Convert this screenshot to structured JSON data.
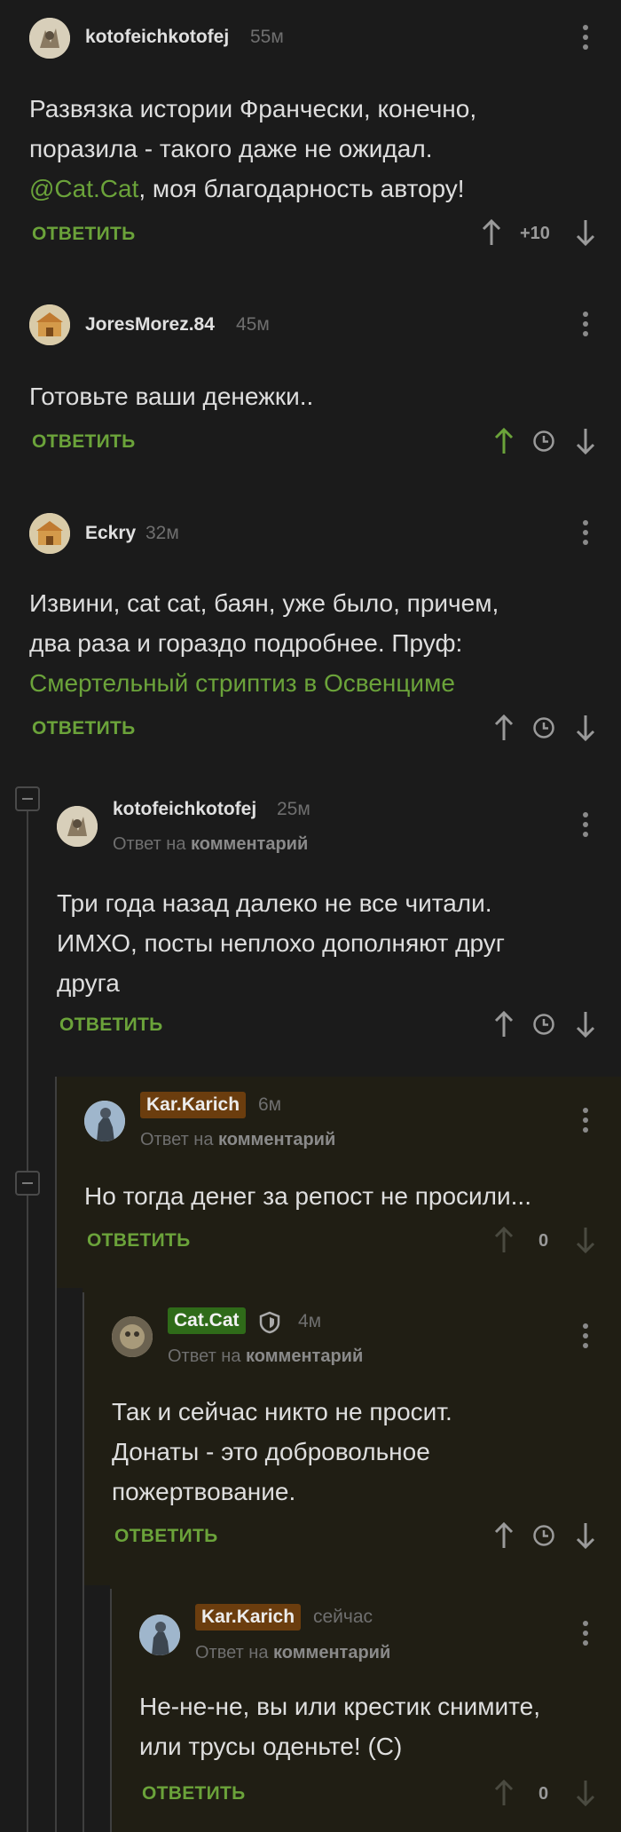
{
  "comments": [
    {
      "id": "c1",
      "author": "kotofeichkotofej",
      "time": "55м",
      "body_lines": [
        "Развязка истории Франчески, конечно,",
        "поразила - такого даже не ожидал."
      ],
      "mention": "@Cat.Cat",
      "body_after_mention": ", моя благодарность автору!",
      "answer_label": "ОТВЕТИТЬ",
      "score": "+10"
    },
    {
      "id": "c2",
      "author": "JoresMorez.84",
      "time": "45м",
      "body_lines": [
        "Готовьте ваши денежки.."
      ],
      "answer_label": "ОТВЕТИТЬ"
    },
    {
      "id": "c3",
      "author": "Eckry",
      "time": "32м",
      "body_lines": [
        "Извини, cat cat, баян, уже было, причем,",
        "два раза и гораздо подробнее. Пруф:"
      ],
      "link_text": "Смертельный стриптиз в Освенциме",
      "answer_label": "ОТВЕТИТЬ"
    },
    {
      "id": "c4",
      "author": "kotofeichkotofej",
      "time": "25м",
      "reply_prefix": "Ответ на",
      "reply_target": "комментарий",
      "body_lines": [
        "Три года назад далеко не все читали.",
        "ИМХО, посты неплохо дополняют друг",
        "друга"
      ],
      "answer_label": "ОТВЕТИТЬ"
    },
    {
      "id": "c5",
      "author": "Kar.Karich",
      "time": "6м",
      "reply_prefix": "Ответ на",
      "reply_target": "комментарий",
      "body_lines": [
        "Но тогда денег за репост не просили..."
      ],
      "answer_label": "ОТВЕТИТЬ",
      "score": "0"
    },
    {
      "id": "c6",
      "author": "Cat.Cat",
      "time": "4м",
      "reply_prefix": "Ответ на",
      "reply_target": "комментарий",
      "body_lines": [
        "Так и сейчас никто не просит.",
        "Донаты - это добровольное",
        "пожертвование."
      ],
      "answer_label": "ОТВЕТИТЬ"
    },
    {
      "id": "c7",
      "author": "Kar.Karich",
      "time": "сейчас",
      "reply_prefix": "Ответ на",
      "reply_target": "комментарий",
      "body_lines": [
        "Не-не-не, вы или крестик снимите,",
        "или трусы оденьте! (С)"
      ],
      "answer_label": "ОТВЕТИТЬ",
      "score": "0"
    }
  ],
  "colors": {
    "background": "#1b1b1b",
    "highlight_background": "#201e14",
    "accent_green": "#6ba33a",
    "upvoted_green": "#6ba33a",
    "author_tag_orange": "#6b3d0e",
    "post_author_tag_green": "#2f6b19",
    "muted_text": "#6f6f6f"
  },
  "icons": [
    "upvote-arrow-icon",
    "downvote-arrow-icon",
    "clock-icon",
    "more-vertical-icon",
    "shield-icon",
    "collapse-thread-icon"
  ]
}
